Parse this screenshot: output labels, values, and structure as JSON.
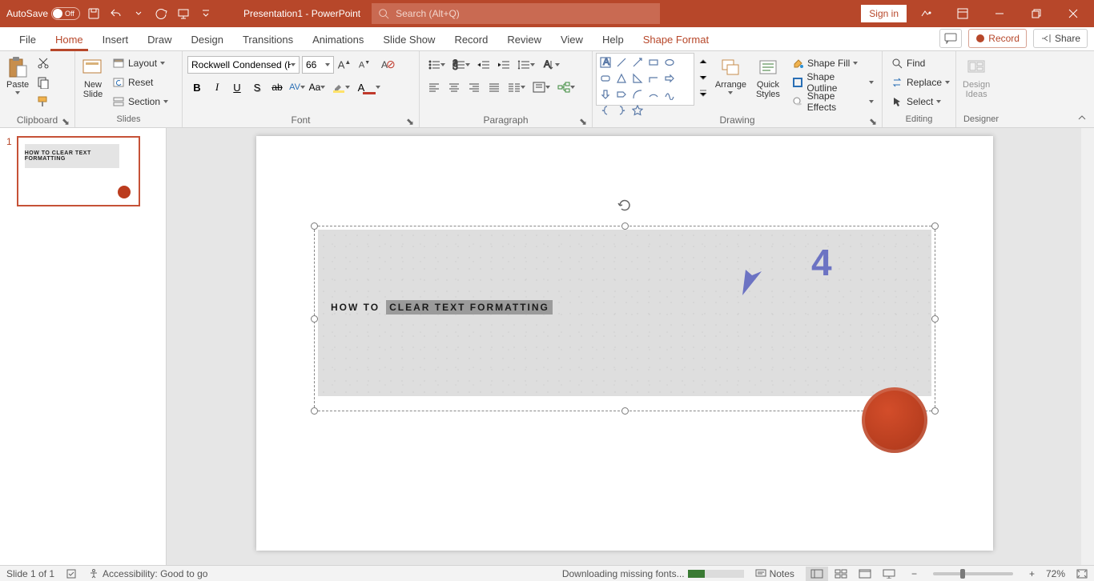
{
  "titlebar": {
    "autosave_label": "AutoSave",
    "autosave_state": "Off",
    "doc_title": "Presentation1  -  PowerPoint",
    "search_placeholder": "Search (Alt+Q)",
    "signin": "Sign in"
  },
  "tabs": [
    "File",
    "Home",
    "Insert",
    "Draw",
    "Design",
    "Transitions",
    "Animations",
    "Slide Show",
    "Record",
    "Review",
    "View",
    "Help",
    "Shape Format"
  ],
  "tabs_active": "Home",
  "menubar_right": {
    "record": "Record",
    "share": "Share"
  },
  "ribbon": {
    "clipboard": {
      "label": "Clipboard",
      "paste": "Paste"
    },
    "slides": {
      "label": "Slides",
      "new_slide": "New\nSlide",
      "layout": "Layout",
      "reset": "Reset",
      "section": "Section"
    },
    "font": {
      "label": "Font",
      "name": "Rockwell Condensed (He",
      "size": "66"
    },
    "paragraph": {
      "label": "Paragraph"
    },
    "drawing": {
      "label": "Drawing",
      "arrange": "Arrange",
      "quick_styles": "Quick\nStyles",
      "shape_fill": "Shape Fill",
      "shape_outline": "Shape Outline",
      "shape_effects": "Shape Effects"
    },
    "editing": {
      "label": "Editing",
      "find": "Find",
      "replace": "Replace",
      "select": "Select"
    },
    "designer": {
      "label": "Designer",
      "design_ideas": "Design\nIdeas"
    }
  },
  "slide": {
    "thumb_num": "1",
    "thumb_text": "HOW TO CLEAR TEXT FORMATTING",
    "title_plain": "HOW TO",
    "title_selected": "CLEAR TEXT FORMATTING",
    "annotation_num": "4"
  },
  "statusbar": {
    "slide_info": "Slide 1 of 1",
    "accessibility": "Accessibility: Good to go",
    "downloading": "Downloading missing fonts...",
    "notes": "Notes",
    "zoom": "72%"
  }
}
